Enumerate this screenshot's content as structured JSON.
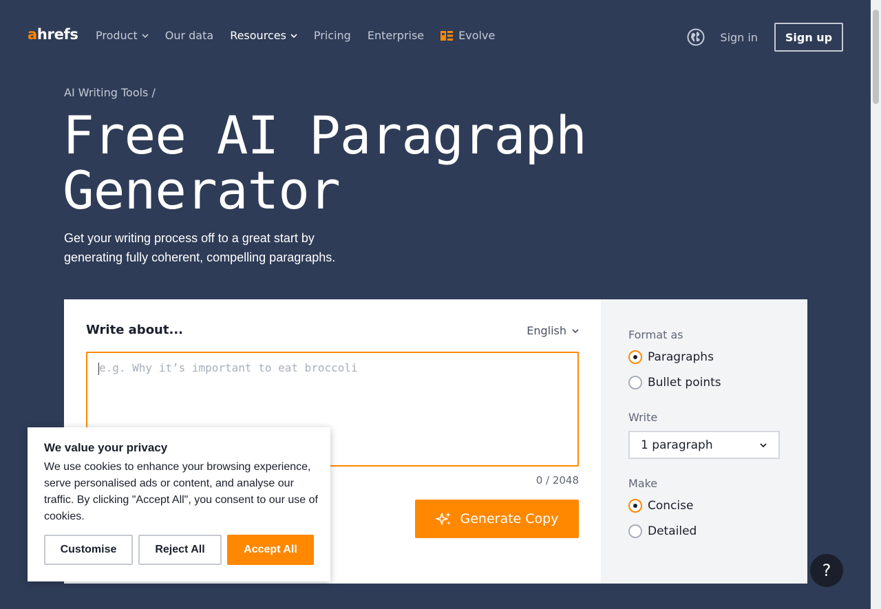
{
  "header": {
    "logo_prefix": "a",
    "logo_rest": "hrefs",
    "nav": [
      {
        "label": "Product",
        "has_dropdown": true
      },
      {
        "label": "Our data",
        "has_dropdown": false
      },
      {
        "label": "Resources",
        "has_dropdown": true,
        "active": true
      },
      {
        "label": "Pricing",
        "has_dropdown": false
      },
      {
        "label": "Enterprise",
        "has_dropdown": false
      },
      {
        "label": "Evolve",
        "has_dropdown": false,
        "icon": "evolve-icon"
      }
    ],
    "globe_icon": "globe-icon",
    "sign_in": "Sign in",
    "sign_up": "Sign up"
  },
  "breadcrumb": "AI Writing Tools /",
  "hero": {
    "title_line1": "Free AI Paragraph",
    "title_line2": "Generator",
    "subtitle_line1": "Get your writing process off to a great start by",
    "subtitle_line2": "generating fully coherent, compelling paragraphs."
  },
  "tool": {
    "write_about": "Write about...",
    "language": "English",
    "input_placeholder": "e.g. Why it’s important to eat broccoli",
    "input_value": "",
    "counter": "0 / 2048",
    "generate_label": "Generate Copy"
  },
  "options": {
    "format_label": "Format as",
    "format_options": [
      {
        "label": "Paragraphs",
        "selected": true
      },
      {
        "label": "Bullet points",
        "selected": false
      }
    ],
    "write_label": "Write",
    "write_value": "1 paragraph",
    "make_label": "Make",
    "make_options": [
      {
        "label": "Concise",
        "selected": true
      },
      {
        "label": "Detailed",
        "selected": false
      }
    ]
  },
  "cookie": {
    "title": "We value your privacy",
    "text": "We use cookies to enhance your browsing experience, serve personalised ads or content, and analyse our traffic. By clicking \"Accept All\", you consent to our use of cookies.",
    "customise": "Customise",
    "reject": "Reject All",
    "accept": "Accept All"
  },
  "help_label": "?",
  "colors": {
    "background": "#2f3c57",
    "accent": "#ff8800",
    "panel": "#ffffff",
    "side_panel": "#f3f4f6"
  }
}
